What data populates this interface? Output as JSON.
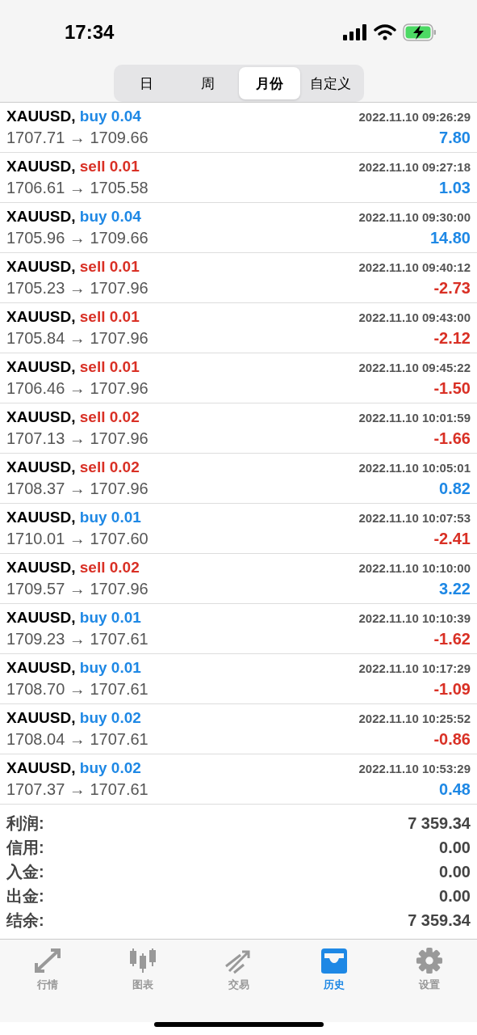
{
  "status_bar": {
    "time": "17:34"
  },
  "segments": [
    {
      "label": "日",
      "selected": false
    },
    {
      "label": "周",
      "selected": false
    },
    {
      "label": "月份",
      "selected": true
    },
    {
      "label": "自定义",
      "selected": false
    }
  ],
  "deals": [
    {
      "symbol": "XAUUSD,",
      "order": "buy 0.04",
      "kind": "buy",
      "time": "2022.11.10 09:26:29",
      "prices": "1707.71 → 1709.66",
      "profit": "7.80",
      "positive": true
    },
    {
      "symbol": "XAUUSD,",
      "order": "sell 0.01",
      "kind": "sell",
      "time": "2022.11.10 09:27:18",
      "prices": "1706.61 → 1705.58",
      "profit": "1.03",
      "positive": true
    },
    {
      "symbol": "XAUUSD,",
      "order": "buy 0.04",
      "kind": "buy",
      "time": "2022.11.10 09:30:00",
      "prices": "1705.96 → 1709.66",
      "profit": "14.80",
      "positive": true
    },
    {
      "symbol": "XAUUSD,",
      "order": "sell 0.01",
      "kind": "sell",
      "time": "2022.11.10 09:40:12",
      "prices": "1705.23 → 1707.96",
      "profit": "-2.73",
      "positive": false
    },
    {
      "symbol": "XAUUSD,",
      "order": "sell 0.01",
      "kind": "sell",
      "time": "2022.11.10 09:43:00",
      "prices": "1705.84 → 1707.96",
      "profit": "-2.12",
      "positive": false
    },
    {
      "symbol": "XAUUSD,",
      "order": "sell 0.01",
      "kind": "sell",
      "time": "2022.11.10 09:45:22",
      "prices": "1706.46 → 1707.96",
      "profit": "-1.50",
      "positive": false
    },
    {
      "symbol": "XAUUSD,",
      "order": "sell 0.02",
      "kind": "sell",
      "time": "2022.11.10 10:01:59",
      "prices": "1707.13 → 1707.96",
      "profit": "-1.66",
      "positive": false
    },
    {
      "symbol": "XAUUSD,",
      "order": "sell 0.02",
      "kind": "sell",
      "time": "2022.11.10 10:05:01",
      "prices": "1708.37 → 1707.96",
      "profit": "0.82",
      "positive": true
    },
    {
      "symbol": "XAUUSD,",
      "order": "buy 0.01",
      "kind": "buy",
      "time": "2022.11.10 10:07:53",
      "prices": "1710.01 → 1707.60",
      "profit": "-2.41",
      "positive": false
    },
    {
      "symbol": "XAUUSD,",
      "order": "sell 0.02",
      "kind": "sell",
      "time": "2022.11.10 10:10:00",
      "prices": "1709.57 → 1707.96",
      "profit": "3.22",
      "positive": true
    },
    {
      "symbol": "XAUUSD,",
      "order": "buy 0.01",
      "kind": "buy",
      "time": "2022.11.10 10:10:39",
      "prices": "1709.23 → 1707.61",
      "profit": "-1.62",
      "positive": false
    },
    {
      "symbol": "XAUUSD,",
      "order": "buy 0.01",
      "kind": "buy",
      "time": "2022.11.10 10:17:29",
      "prices": "1708.70 → 1707.61",
      "profit": "-1.09",
      "positive": false
    },
    {
      "symbol": "XAUUSD,",
      "order": "buy 0.02",
      "kind": "buy",
      "time": "2022.11.10 10:25:52",
      "prices": "1708.04 → 1707.61",
      "profit": "-0.86",
      "positive": false
    },
    {
      "symbol": "XAUUSD,",
      "order": "buy 0.02",
      "kind": "buy",
      "time": "2022.11.10 10:53:29",
      "prices": "1707.37 → 1707.61",
      "profit": "0.48",
      "positive": true
    }
  ],
  "summary": [
    {
      "label": "利润:",
      "value": "7 359.34"
    },
    {
      "label": "信用:",
      "value": "0.00"
    },
    {
      "label": "入金:",
      "value": "0.00"
    },
    {
      "label": "出金:",
      "value": "0.00"
    },
    {
      "label": "结余:",
      "value": "7 359.34"
    }
  ],
  "tab_bar": [
    {
      "label": "行情",
      "kind": "quotes",
      "selected": false
    },
    {
      "label": "图表",
      "kind": "chart",
      "selected": false
    },
    {
      "label": "交易",
      "kind": "trade",
      "selected": false
    },
    {
      "label": "历史",
      "kind": "history",
      "selected": true
    },
    {
      "label": "设置",
      "kind": "settings",
      "selected": false
    }
  ]
}
